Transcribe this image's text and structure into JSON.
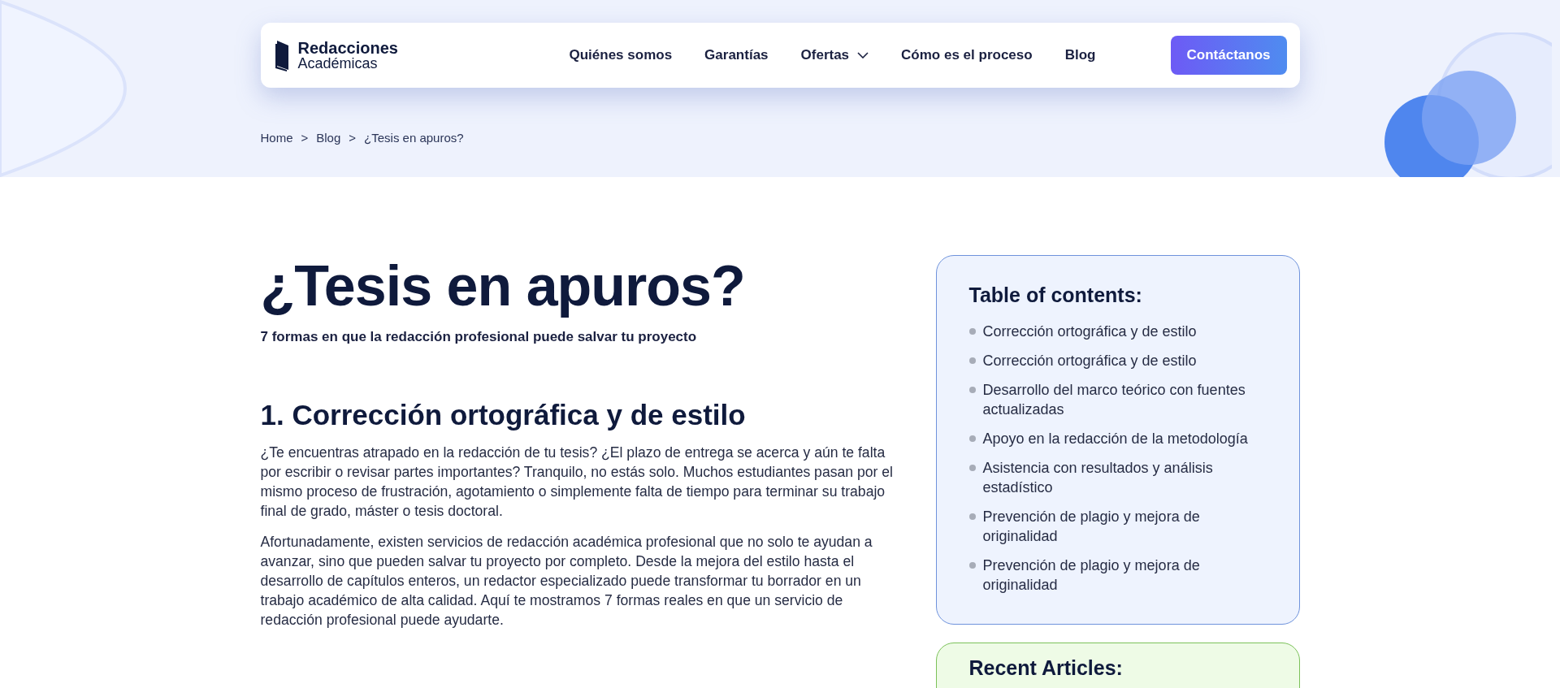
{
  "header": {
    "logo": {
      "line_1": "Redacciones",
      "line_2": "Académicas"
    },
    "nav": [
      {
        "label": "Quiénes somos",
        "kind": "link"
      },
      {
        "label": "Garantías",
        "kind": "link"
      },
      {
        "label": "Ofertas",
        "kind": "dropdown"
      },
      {
        "label": "Cómo es el proceso",
        "kind": "link"
      },
      {
        "label": "Blog",
        "kind": "link"
      }
    ],
    "cta": "Contáctanos"
  },
  "breadcrumb": {
    "items": [
      "Home",
      "Blog",
      "¿Tesis en apuros?"
    ],
    "separator": ">"
  },
  "article": {
    "title": "¿Tesis en apuros?",
    "subtitle": "7 formas en que la redacción profesional puede salvar tu proyecto",
    "sections": [
      {
        "heading": "1. Corrección ortográfica y de estilo",
        "paragraphs": [
          "¿Te encuentras atrapado en la redacción de tu tesis? ¿El plazo de entrega se acerca y aún te falta por escribir o revisar partes importantes? Tranquilo, no estás solo. Muchos estudiantes pasan por el mismo proceso de frustración, agotamiento o simplemente falta de tiempo para terminar su trabajo final de grado, máster o tesis doctoral.",
          "Afortunadamente, existen servicios de redacción académica profesional que no solo te ayudan a avanzar, sino que pueden salvar tu proyecto por completo. Desde la mejora del estilo hasta el desarrollo de capítulos enteros, un redactor especializado puede transformar tu borrador en un trabajo académico de alta calidad. Aquí te mostramos 7 formas reales en que un servicio de redacción profesional puede ayudarte."
        ]
      }
    ]
  },
  "sidebar": {
    "toc": {
      "title": "Table of contents:",
      "items": [
        "Corrección ortográfica y de estilo",
        "Corrección ortográfica y de estilo",
        "Desarrollo del marco teórico con fuentes actualizadas",
        "Apoyo en la redacción de la metodología",
        "Asistencia con resultados y análisis estadístico",
        "Prevención de plagio y mejora de originalidad",
        "Prevención de plagio y mejora de originalidad"
      ]
    },
    "recent": {
      "title": "Recent Articles:"
    }
  }
}
